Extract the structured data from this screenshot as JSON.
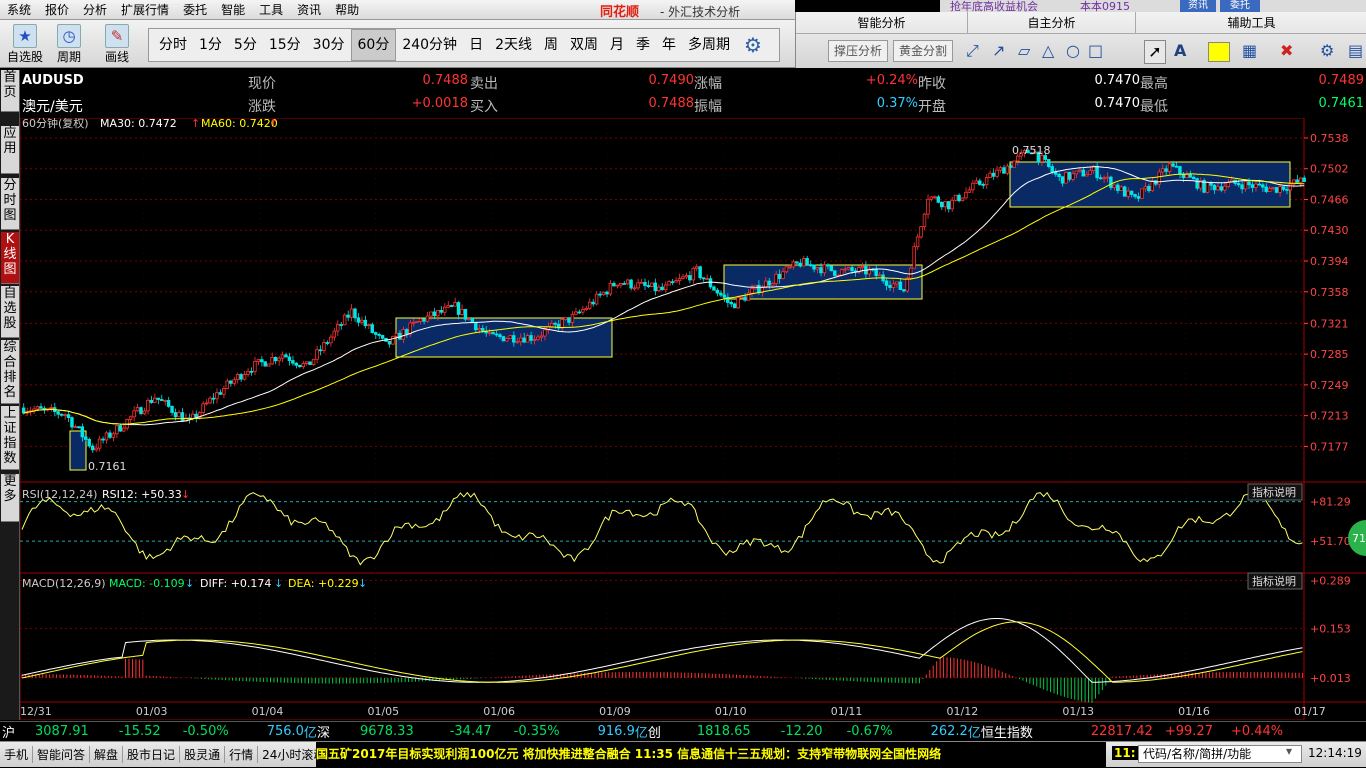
{
  "menu": [
    "系统",
    "报价",
    "分析",
    "扩展行情",
    "委托",
    "智能",
    "工具",
    "资讯",
    "帮助"
  ],
  "brand": "同花顺",
  "app_title": "- 外汇技术分析",
  "top_strip": {
    "notice": "抢年底高收益机会",
    "user": "本本0915",
    "btn1": "资讯",
    "btn2": "委托"
  },
  "toolbar": {
    "self_select": "自选股",
    "period": "周期",
    "draw": "画线"
  },
  "periods": [
    "分时",
    "1分",
    "5分",
    "15分",
    "30分",
    "60分",
    "240分钟",
    "日",
    "2天线",
    "周",
    "双周",
    "月",
    "季",
    "年",
    "多周期"
  ],
  "selected_period": "60分",
  "right_panel": {
    "smart": "智能分析",
    "self": "自主分析",
    "aux": "辅助工具",
    "btn_support": "撑压分析",
    "btn_golden": "黄金分割"
  },
  "left_tabs": [
    "首页",
    "应用",
    "分时图",
    "K线图",
    "自选股",
    "综合排名",
    "上证指数",
    "更多"
  ],
  "quote": {
    "code": "AUDUSD",
    "name": "澳元/美元",
    "l_price": "现价",
    "price": "0.7488",
    "l_change": "涨跌",
    "change": "+0.0018",
    "l_sell": "卖出",
    "sell": "0.7490",
    "l_buy": "买入",
    "buy": "0.7488",
    "l_pct": "涨幅",
    "pct": "+0.24%",
    "l_amp": "振幅",
    "amp": "0.37%",
    "l_prev": "昨收",
    "prev": "0.7470",
    "l_open": "开盘",
    "open": "0.7470",
    "l_high": "最高",
    "high": "0.7489",
    "l_low": "最低",
    "low": "0.7461"
  },
  "ma_legend": {
    "period": "60分钟(复权)",
    "ma30": "MA30: 0.7472",
    "ma60": "MA60: 0.7420"
  },
  "colors": {
    "up": "#ff3333",
    "down": "#00e5e5",
    "ma30": "#ffffff",
    "ma60": "#ffff00",
    "grid": "#8b0000"
  },
  "chart_data": {
    "type": "candlestick",
    "price_ticks": [
      "0.7538",
      "0.7502",
      "0.7466",
      "0.7430",
      "0.7394",
      "0.7358",
      "0.7321",
      "0.7285",
      "0.7249",
      "0.7213",
      "0.7177"
    ],
    "price_range": [
      0.714,
      0.7545
    ],
    "x_labels": [
      "12/31",
      "01/03",
      "01/04",
      "01/05",
      "01/06",
      "01/09",
      "01/10",
      "01/11",
      "01/12",
      "01/13",
      "01/16",
      "01/17"
    ],
    "annotations": {
      "high": "0.7518",
      "low": "0.7161"
    },
    "path": [
      [
        0,
        0.7222
      ],
      [
        12,
        0.7215
      ],
      [
        20,
        0.7175
      ],
      [
        28,
        0.72
      ],
      [
        38,
        0.7235
      ],
      [
        48,
        0.7205
      ],
      [
        55,
        0.7235
      ],
      [
        65,
        0.7268
      ],
      [
        75,
        0.7285
      ],
      [
        82,
        0.727
      ],
      [
        95,
        0.7335
      ],
      [
        105,
        0.7295
      ],
      [
        115,
        0.7325
      ],
      [
        125,
        0.734
      ],
      [
        135,
        0.7305
      ],
      [
        148,
        0.7305
      ],
      [
        160,
        0.733
      ],
      [
        172,
        0.737
      ],
      [
        185,
        0.736
      ],
      [
        195,
        0.7382
      ],
      [
        205,
        0.7342
      ],
      [
        215,
        0.7368
      ],
      [
        225,
        0.7392
      ],
      [
        235,
        0.7382
      ],
      [
        245,
        0.7382
      ],
      [
        255,
        0.736
      ],
      [
        262,
        0.747
      ],
      [
        268,
        0.746
      ],
      [
        275,
        0.748
      ],
      [
        285,
        0.7505
      ],
      [
        292,
        0.7525
      ],
      [
        300,
        0.749
      ],
      [
        310,
        0.75
      ],
      [
        322,
        0.7465
      ],
      [
        332,
        0.7505
      ],
      [
        342,
        0.748
      ],
      [
        352,
        0.7485
      ],
      [
        362,
        0.7478
      ],
      [
        371,
        0.7488
      ]
    ],
    "rsi": {
      "label": "RSI(12,12,24)",
      "value": "RSI12: +50.33",
      "ticks": [
        "+81.29",
        "+51.70"
      ],
      "badge": "71"
    },
    "macd": {
      "label": "MACD(12,26,9)",
      "macd": "MACD: -0.109",
      "diff": "DIFF: +0.174",
      "dea": "DEA: +0.229",
      "ticks": [
        "+0.289",
        "+0.153",
        "+0.013"
      ]
    },
    "indicator_btn": "指标说明"
  },
  "status": {
    "sh": "沪",
    "sh_val": "3087.91",
    "sh_chg": "-15.52",
    "sh_pct": "-0.50%",
    "sh_amt": "756.0",
    "yi1": "亿",
    "sz": "深",
    "sz_val": "9678.33",
    "sz_chg": "-34.47",
    "sz_pct": "-0.35%",
    "sz_amt": "916.9",
    "yi2": "亿",
    "cy": "创",
    "cy_val": "1818.65",
    "cy_chg": "-12.20",
    "cy_pct": "-0.67%",
    "cy_amt": "262.2",
    "yi3": "亿",
    "hs": "恒生指数",
    "hs_val": "22817.42",
    "hs_chg": "+99.27",
    "hs_pct": "+0.44%"
  },
  "bottom": {
    "tabs": [
      "手机",
      "智能问答",
      "解盘",
      "股市日记",
      "股灵通",
      "行情",
      "24小时滚动"
    ],
    "ticker": "国五矿2017年目标实现利润100亿元  将加快推进整合融合          11:35  信息通信十三五规划：支持窄带物联网全国性网络",
    "ticker_time": "11:",
    "search_placeholder": "代码/名称/简拼/功能",
    "clock": "12:14:19"
  }
}
